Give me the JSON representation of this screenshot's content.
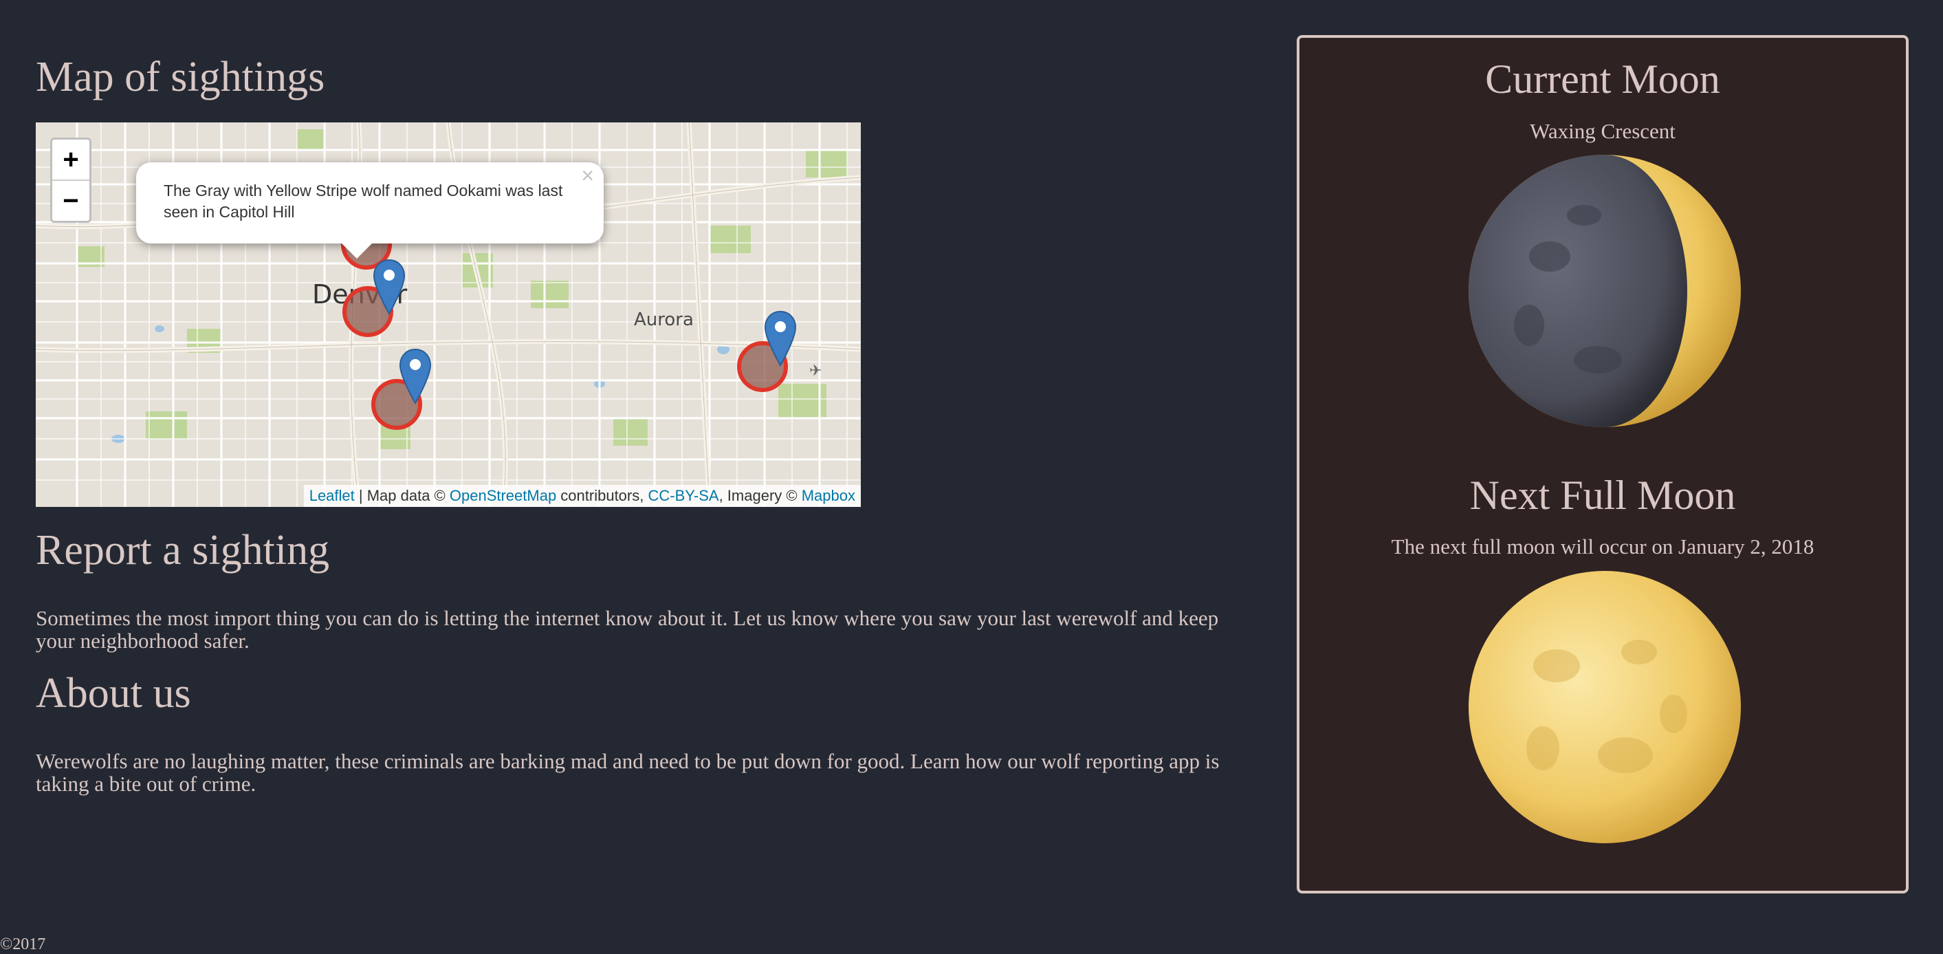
{
  "map_section": {
    "heading": "Map of sightings",
    "zoom_in": "+",
    "zoom_out": "−",
    "popup_text": "The Gray with Yellow Stripe wolf named Ookami was last seen in Capitol Hill",
    "popup_close": "×",
    "places": {
      "denver": "Denver",
      "aurora": "Aurora"
    },
    "attribution": {
      "leaflet": "Leaflet",
      "sep": " | Map data © ",
      "osm": "OpenStreetMap",
      "contrib": " contributors, ",
      "license": "CC-BY-SA",
      "imagery": ", Imagery © ",
      "mapbox": "Mapbox"
    }
  },
  "report_section": {
    "heading": "Report a sighting",
    "text": "Sometimes the most import thing you can do is letting the internet know about it. Let us know where you saw your last werewolf and keep your neighborhood safer."
  },
  "about_section": {
    "heading": "About us",
    "text": "Werewolfs are no laughing matter, these criminals are barking mad and need to be put down for good. Learn how our wolf reporting app is taking a bite out of crime."
  },
  "moon_panel": {
    "current_title": "Current Moon",
    "current_phase": "Waxing Crescent",
    "current_icon": "waxing-crescent-moon",
    "next_title": "Next Full Moon",
    "next_text": "The next full moon will occur on January 2, 2018",
    "next_icon": "full-moon"
  },
  "footer": {
    "text": "©2017"
  },
  "colors": {
    "background": "#242832",
    "panel": "#2f2222",
    "text": "#d8c7c4",
    "link": "#0078a8",
    "marker": "#3d7dc4",
    "circle": "#e0362a"
  }
}
